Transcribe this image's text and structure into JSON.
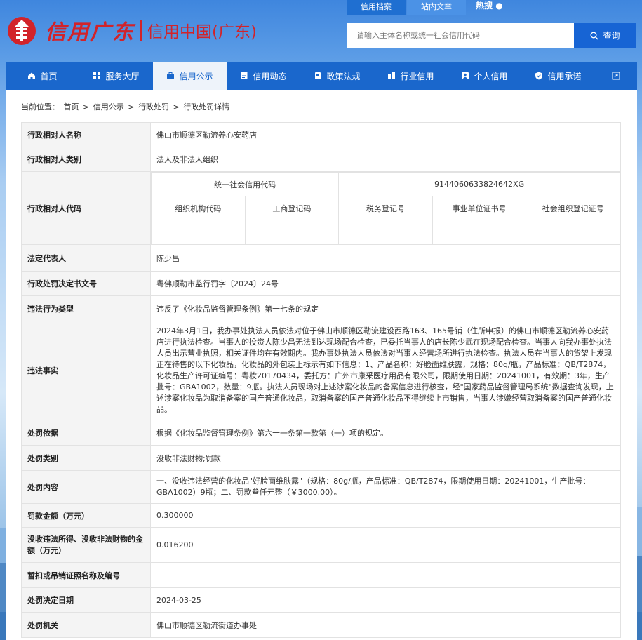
{
  "header": {
    "logo_script": "信用广东",
    "logo_text": "信用中国(广东)",
    "top_tabs": [
      "信用档案",
      "站内文章"
    ],
    "hot_label": "热搜",
    "search_placeholder": "请输入主体名称或统一社会信用代码",
    "search_button": "查询"
  },
  "nav": {
    "items": [
      {
        "label": "首页",
        "icon": "home-icon"
      },
      {
        "label": "服务大厅",
        "icon": "grid-icon"
      },
      {
        "label": "信用公示",
        "icon": "briefcase-icon"
      },
      {
        "label": "信用动态",
        "icon": "news-icon"
      },
      {
        "label": "政策法规",
        "icon": "book-icon"
      },
      {
        "label": "行业信用",
        "icon": "building-icon"
      },
      {
        "label": "个人信用",
        "icon": "person-icon"
      },
      {
        "label": "信用承诺",
        "icon": "shield-icon"
      }
    ],
    "active_index": 2
  },
  "breadcrumb": {
    "prefix": "当前位置：",
    "items": [
      "首页",
      "信用公示",
      "行政处罚",
      "行政处罚详情"
    ],
    "separator": ">"
  },
  "detail": {
    "name_label": "行政相对人名称",
    "name_value": "佛山市顺德区勒流养心安药店",
    "type_label": "行政相对人类别",
    "type_value": "法人及非法人组织",
    "code_label": "行政相对人代码",
    "usc_label": "统一社会信用代码",
    "usc_value": "9144060633824642XG",
    "sub_headers": [
      "组织机构代码",
      "工商登记码",
      "税务登记号",
      "事业单位证书号",
      "社会组织登记证号"
    ],
    "legal_rep_label": "法定代表人",
    "legal_rep_value": "陈少昌",
    "doc_no_label": "行政处罚决定书文号",
    "doc_no_value": "粤佛顺勒市监行罚字〔2024〕24号",
    "violation_type_label": "违法行为类型",
    "violation_type_value": "违反了《化妆品监督管理条例》第十七条的规定",
    "facts_label": "违法事实",
    "facts_value": "2024年3月1日，我办事处执法人员依法对位于佛山市顺德区勒流建设西路163、165号铺（住所申报）的佛山市顺德区勒流养心安药店进行执法检查。当事人的投资人陈少昌无法到达现场配合检查，已委托当事人的店长陈少武在现场配合检查。当事人向我办事处执法人员出示营业执照，相关证件均在有效期内。我办事处执法人员依法对当事人经营场所进行执法检查。执法人员在当事人的货架上发现正在待售的以下化妆品，化妆品的外包装上标示有如下信息：1、产品名称：好脸面维肤露，规格：80g/瓶，产品标准：QB/T2874，化妆品生产许可证编号：粤妆20170434，委托方：广州市康采医疗用品有限公司，限期使用日期：20241001，有效期：3年，生产批号：GBA1002，数量：9瓶。执法人员现场对上述涉案化妆品的备案信息进行核查，经\"国家药品监督管理局系统\"数据查询发现，上述涉案化妆品为取消备案的国产普通化妆品，取消备案的国产普通化妆品不得继续上市销售，当事人涉嫌经营取消备案的国产普通化妆品。",
    "basis_label": "处罚依据",
    "basis_value": "根据《化妆品监督管理条例》第六十一条第一款第（一）项的规定。",
    "category_label": "处罚类别",
    "category_value": "没收非法财物;罚款",
    "content_label": "处罚内容",
    "content_value": "一、没收违法经营的化妆品\"好脸面维肤露\"（规格：80g/瓶，产品标准：QB/T2874，限期使用日期：20241001，生产批号：GBA1002）9瓶；二、罚款叁仟元整（￥3000.00）。",
    "fine_label": "罚款金额（万元）",
    "fine_value": "0.300000",
    "confiscate_label": "没收违法所得、没收非法财物的金额（万元）",
    "confiscate_value": "0.016200",
    "license_label": "暂扣或吊销证照名称及编号",
    "license_value": "",
    "date_label": "处罚决定日期",
    "date_value": "2024-03-25",
    "authority_label": "处罚机关",
    "authority_value": "佛山市顺德区勒流街道办事处"
  }
}
